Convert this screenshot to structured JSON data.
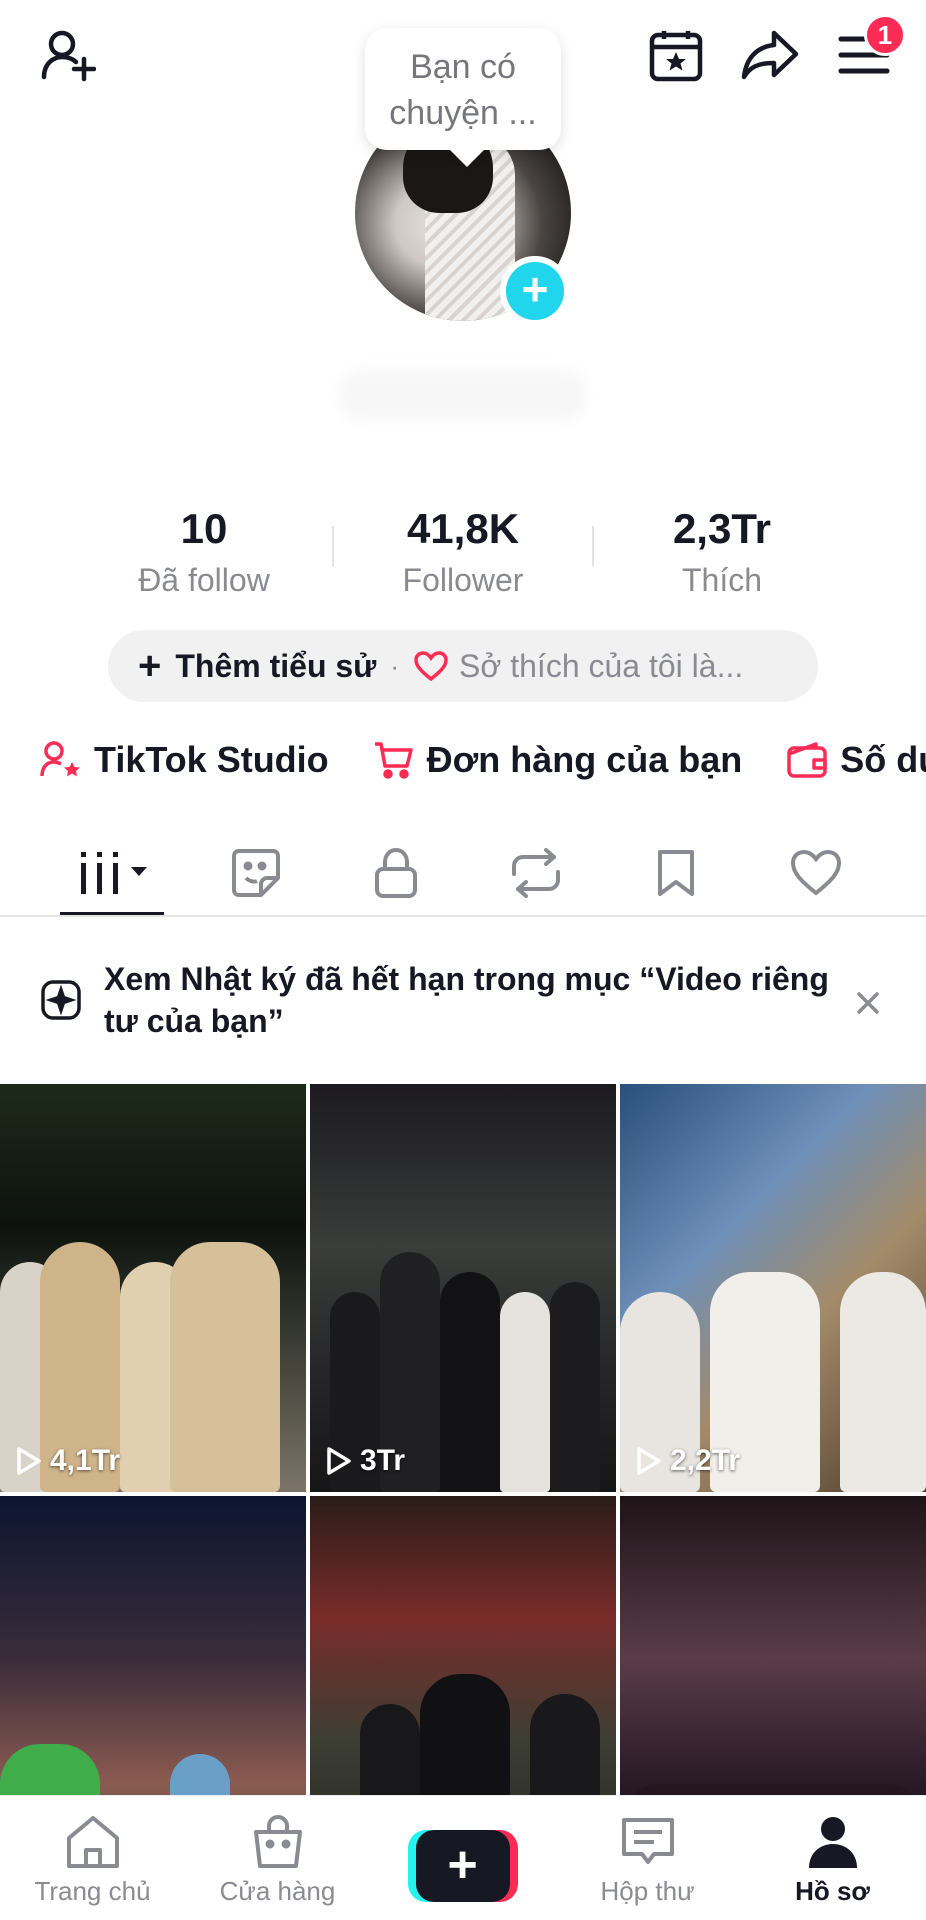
{
  "bubble": {
    "line1": "Bạn có",
    "line2": "chuyện ..."
  },
  "notifications_count": "1",
  "stats": [
    {
      "value": "10",
      "label": "Đã follow"
    },
    {
      "value": "41,8K",
      "label": "Follower"
    },
    {
      "value": "2,3Tr",
      "label": "Thích"
    }
  ],
  "bio": {
    "add_label": "Thêm tiểu sử",
    "separator": "·",
    "hobby_placeholder": "Sở thích của tôi là..."
  },
  "shortcuts": [
    {
      "label": "TikTok Studio",
      "icon": "person-star-icon"
    },
    {
      "label": "Đơn hàng của bạn",
      "icon": "cart-icon"
    },
    {
      "label": "Số dư",
      "icon": "wallet-icon"
    }
  ],
  "tabs": [
    {
      "name": "videos",
      "icon": "grid-icon"
    },
    {
      "name": "stickers",
      "icon": "sticker-icon"
    },
    {
      "name": "private",
      "icon": "lock-icon"
    },
    {
      "name": "reposts",
      "icon": "repost-icon"
    },
    {
      "name": "favorites",
      "icon": "bookmark-icon"
    },
    {
      "name": "liked",
      "icon": "heart-icon"
    }
  ],
  "notice": {
    "text": "Xem Nhật ký đã hết hạn trong mục “Video riêng tư của bạn”"
  },
  "videos": [
    {
      "views": "4,1Tr"
    },
    {
      "views": "3Tr"
    },
    {
      "views": "2,2Tr"
    },
    {
      "views": ""
    },
    {
      "views": ""
    },
    {
      "views": ""
    }
  ],
  "bottom_nav": [
    {
      "label": "Trang chủ",
      "icon": "home-icon"
    },
    {
      "label": "Cửa hàng",
      "icon": "shop-bag-icon"
    },
    {
      "label": "",
      "icon": "create-icon"
    },
    {
      "label": "Hộp thư",
      "icon": "inbox-icon"
    },
    {
      "label": "Hồ sơ",
      "icon": "profile-icon"
    }
  ],
  "colors": {
    "accent": "#fe2c55",
    "cyan": "#20d5ec",
    "text": "#161823",
    "muted": "#8a8b91"
  }
}
